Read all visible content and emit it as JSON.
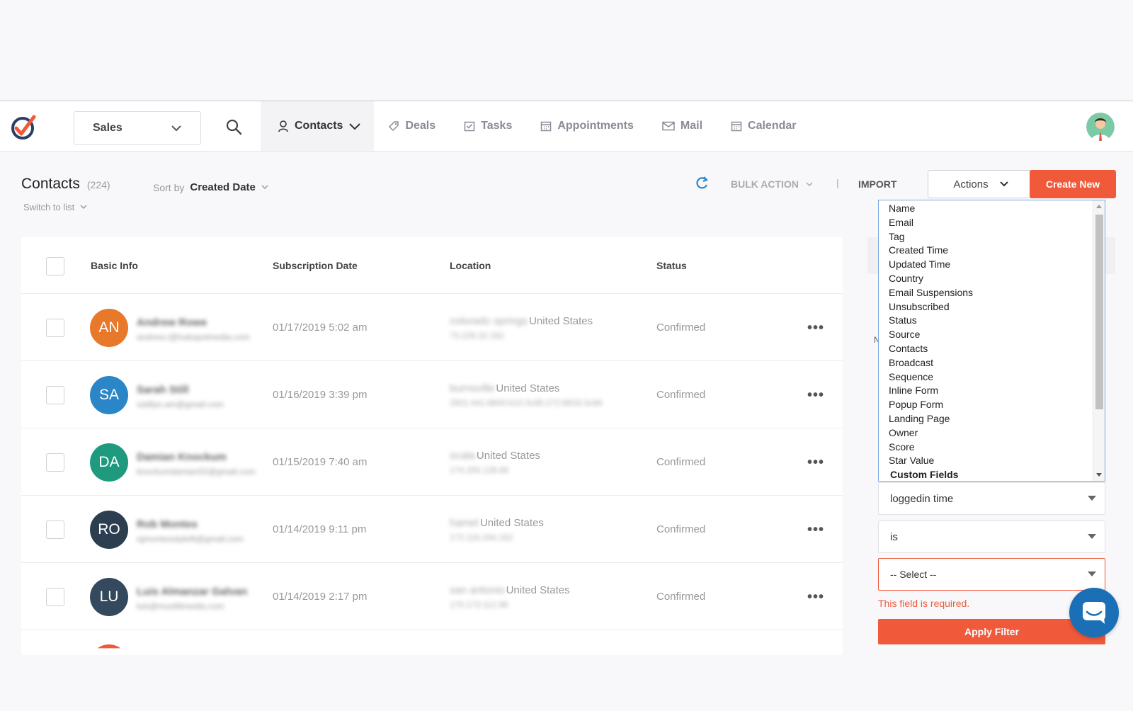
{
  "nav": {
    "pipeline": "Sales",
    "items": [
      {
        "label": "Contacts",
        "icon": "user-icon",
        "active": true
      },
      {
        "label": "Deals",
        "icon": "tag-icon"
      },
      {
        "label": "Tasks",
        "icon": "tasks-icon"
      },
      {
        "label": "Appointments",
        "icon": "calendar-grid-icon"
      },
      {
        "label": "Mail",
        "icon": "mail-icon"
      },
      {
        "label": "Calendar",
        "icon": "calendar-icon"
      }
    ]
  },
  "header": {
    "title": "Contacts",
    "count": "(224)",
    "sort_label": "Sort by",
    "sort_value": "Created Date",
    "switch_label": "Switch to list",
    "bulk_action": "BULK ACTION",
    "separator": "|",
    "import": "IMPORT",
    "actions": "Actions",
    "create_new": "Create New"
  },
  "table": {
    "columns": [
      "Basic Info",
      "Subscription Date",
      "Location",
      "Status"
    ],
    "rows": [
      {
        "initials": "AN",
        "color": "#e8792b",
        "name": "Andrew Rowe",
        "email": "andrew.r@hubspotmedia.com",
        "date": "01/17/2019 5:02 am",
        "loc_prefix": "colorado springs",
        "country": "United States",
        "ip": "73.229.32.162",
        "status": "Confirmed"
      },
      {
        "initials": "SA",
        "color": "#2a86c7",
        "name": "Sarah Still",
        "email": "sstillyo.am@gmail.com",
        "date": "01/16/2019 3:39 pm",
        "loc_prefix": "burnsville",
        "country": "United States",
        "ip": "2601:441:8800:b10:3c85:272:8633:3c86",
        "status": "Confirmed"
      },
      {
        "initials": "DA",
        "color": "#1f9a7f",
        "name": "Damian Knockum",
        "email": "knockumdamian02@gmail.com",
        "date": "01/15/2019 7:40 am",
        "loc_prefix": "ocala",
        "country": "United States",
        "ip": "174.255.128.66",
        "status": "Confirmed"
      },
      {
        "initials": "RO",
        "color": "#2c3e50",
        "name": "Rob Montes",
        "email": "rgmontesstylefit@gmail.com",
        "date": "01/14/2019 9:11 pm",
        "loc_prefix": "hamel",
        "country": "United States",
        "ip": "172.116.244.162",
        "status": "Confirmed"
      },
      {
        "initials": "LU",
        "color": "#34495e",
        "name": "Luis Almanzar Galvan",
        "email": "luis@mostlitmedia.com",
        "date": "01/14/2019 2:17 pm",
        "loc_prefix": "san antonio",
        "country": "United States",
        "ip": "170.173.112.98",
        "status": "Confirmed"
      }
    ],
    "partial_row_color": "#f0593a"
  },
  "filter": {
    "options": [
      "Name",
      "Email",
      "Tag",
      "Created Time",
      "Updated Time",
      "Country",
      "Email Suspensions",
      "Unsubscribed",
      "Status",
      "Source",
      "Contacts",
      "Broadcast",
      "Sequence",
      "Inline Form",
      "Popup Form",
      "Landing Page",
      "Owner",
      "Score",
      "Star Value"
    ],
    "group_header": "Custom Fields",
    "field_value": "loggedin time",
    "operator_value": "is",
    "value_placeholder": "-- Select --",
    "error": "This field is required.",
    "apply": "Apply Filter",
    "side_letter": "N"
  },
  "colors": {
    "accent": "#f0593a",
    "chat": "#1b6fb6"
  }
}
